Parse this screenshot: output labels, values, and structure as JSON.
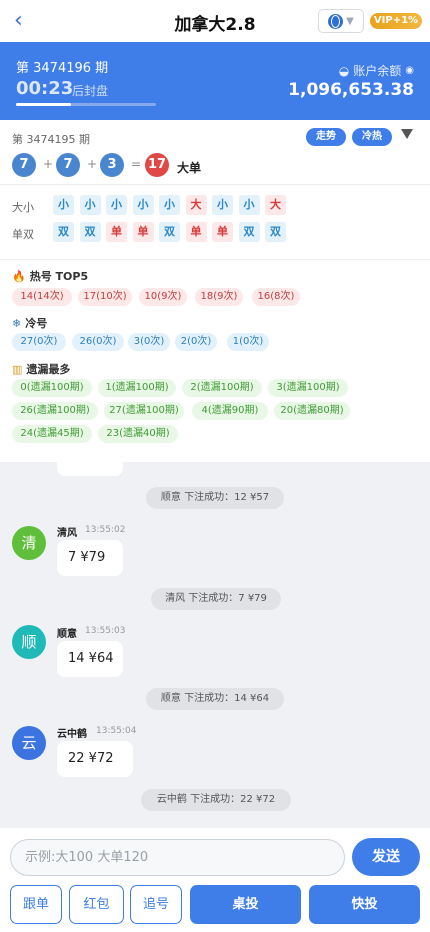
{
  "header": {
    "back_icon": "‹",
    "title": "加拿大2.8",
    "vip_label": "VIP+1%",
    "dropdown_icon": "▼"
  },
  "banner": {
    "period": "第 3474196 期",
    "countdown": "00:23",
    "status": "后封盘",
    "progress_fraction": 0.39,
    "balance_label": "账户余额",
    "balance": "1,096,653.38"
  },
  "last_draw": {
    "period": "第 3474195 期",
    "ball1": "7",
    "ball2": "7",
    "ball3": "3",
    "plus1": "+",
    "plus2": "+",
    "equals": "=",
    "sum": "17",
    "result_label": "大单",
    "trend_btn": "走势",
    "hotcold_btn": "冷热"
  },
  "history": {
    "size_label": "大小",
    "parity_label": "单双",
    "size": [
      "小",
      "小",
      "小",
      "小",
      "小",
      "大",
      "小",
      "小",
      "大"
    ],
    "parity": [
      "双",
      "双",
      "单",
      "单",
      "双",
      "单",
      "单",
      "双",
      "双"
    ]
  },
  "hot": {
    "title": "热号 TOP5",
    "items": [
      "14(14次)",
      "17(10次)",
      "10(9次)",
      "18(9次)",
      "16(8次)"
    ]
  },
  "cold": {
    "title": "冷号",
    "items": [
      "27(0次)",
      "26(0次)",
      "3(0次)",
      "2(0次)",
      "1(0次)"
    ]
  },
  "missing": {
    "title": "遗漏最多",
    "items": [
      "0(遗漏100期)",
      "1(遗漏100期)",
      "2(遗漏100期)",
      "3(遗漏100期)",
      "26(遗漏100期)",
      "27(遗漏100期)",
      "4(遗漏90期)",
      "20(遗漏80期)",
      "24(遗漏45期)",
      "23(遗漏40期)"
    ]
  },
  "chat": {
    "sys1": "顺意 下注成功：12 ¥57",
    "msg1": {
      "avatar": "清",
      "name": "清风",
      "time": "13:55:02",
      "text": "7 ¥79"
    },
    "sys2": "清风 下注成功：7 ¥79",
    "msg2": {
      "avatar": "顺",
      "name": "顺意",
      "time": "13:55:03",
      "text": "14 ¥64"
    },
    "sys3": "顺意 下注成功：14 ¥64",
    "msg3": {
      "avatar": "云",
      "name": "云中鹤",
      "time": "13:55:04",
      "text": "22 ¥72"
    },
    "sys4": "云中鹤 下注成功：22 ¥72"
  },
  "input": {
    "placeholder": "示例:大100 大单120",
    "send_label": "发送"
  },
  "actions": {
    "follow": "跟单",
    "redpacket": "红包",
    "chase": "追号",
    "table_bet": "桌投",
    "quick_bet": "快投"
  },
  "colors": {
    "primary": "#3f7de8",
    "big": "#d43b3b",
    "small": "#2a87c9",
    "sum_ball": "#e04848",
    "avatar_green": "#5fbf3a",
    "avatar_teal": "#1fbab8",
    "avatar_blue": "#3b73e0"
  }
}
